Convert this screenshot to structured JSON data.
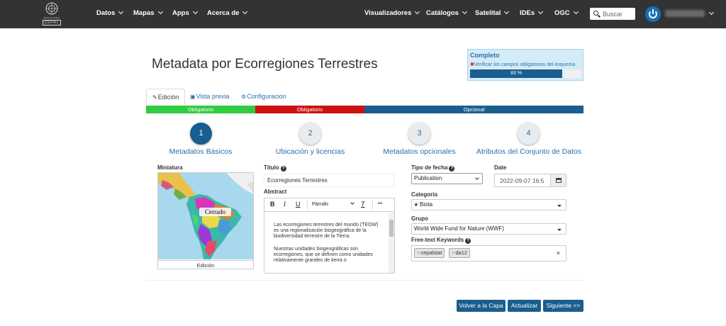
{
  "logo": {
    "text": "Naciones Unidas",
    "org": "CEPAL"
  },
  "nav": {
    "left": [
      "Datos",
      "Mapas",
      "Apps",
      "Acerca de"
    ],
    "right": [
      "Visualizadores",
      "Catálogos",
      "Satelital",
      "IDEs",
      "OGC"
    ]
  },
  "search": {
    "placeholder": "Buscar"
  },
  "page": {
    "title": "Metadata por Ecorregiones Terrestres"
  },
  "status": {
    "title": "Completo",
    "message": "Verificar los campos obligatorios del esquema",
    "progress_label": "83 %",
    "progress_value": 0.83
  },
  "tabs": [
    "Edición",
    "Vista previa",
    "Configuracion"
  ],
  "bands": [
    {
      "label": "Obligatorio",
      "color": "#2ecc40"
    },
    {
      "label": "Obligatorio",
      "color": "#cc1111"
    },
    {
      "label": "Opcional",
      "color": "#1a5d8f"
    }
  ],
  "steps": [
    {
      "number": "1",
      "label": "Metadatos Básicos"
    },
    {
      "number": "2",
      "label": "Ubicación y licencias"
    },
    {
      "number": "3",
      "label": "Metadatos opcionales"
    },
    {
      "number": "4",
      "label": "Atributos del Conjunto de Datos"
    }
  ],
  "form": {
    "miniatura_label": "Miniatura",
    "map_label": "Cerrado",
    "thumb_caption": "Edición",
    "titulo_label": "Título",
    "titulo_value": "Ecorregiones Terrestres",
    "abstract_label": "Abstract",
    "toolbar": {
      "bold": "B",
      "italic": "I",
      "underline": "U",
      "paragraph": "Párrafo",
      "clear": "T",
      "more": "•••"
    },
    "abstract_p1": "Las ecorregiones terrestres del mundo (TEOW) es una regionalización biogeográfica de la biodiversidad terrestre de la Tierra.",
    "abstract_p2": "Nuestras unidades biogeográficas son ecorregiones, que se definen como unidades relativamente grandes de tierra o",
    "tipo_fecha_label": "Tipo de fecha",
    "tipo_fecha_value": "Publication",
    "date_label": "Date",
    "date_value": "2022-09-07 16:5",
    "categoria_label": "Categoría",
    "categoria_value": "Biota",
    "grupo_label": "Grupo",
    "grupo_value": "World Wide Fund for Nature (WWF)",
    "keywords_label": "Free-text Keywords",
    "keywords": [
      "cepalstat",
      "da12"
    ]
  },
  "buttons": {
    "volver": "Volver a la Capa",
    "actualizar": "Actualizar",
    "siguiente": "Siguiente >>"
  },
  "colors": {
    "navbar": "#333333",
    "primary": "#1a5d8f",
    "link": "#2a6fa8"
  }
}
